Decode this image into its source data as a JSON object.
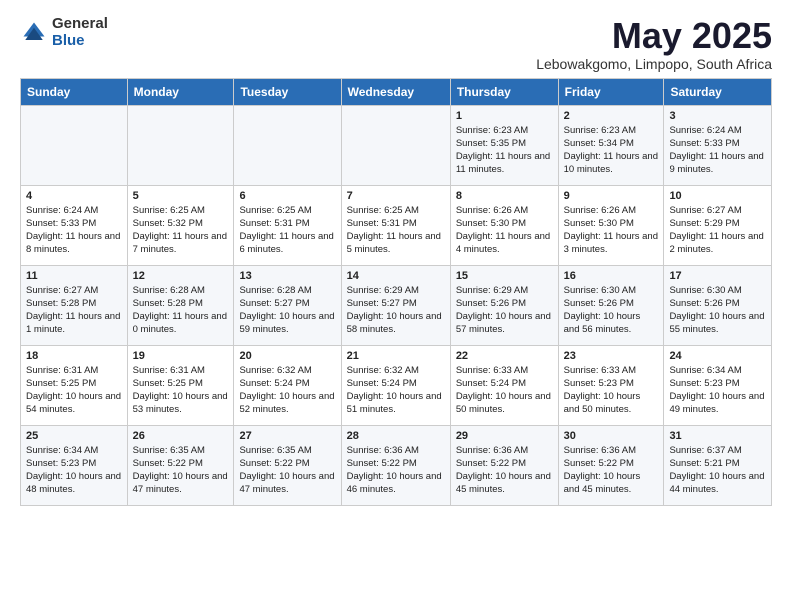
{
  "logo": {
    "general": "General",
    "blue": "Blue"
  },
  "header": {
    "month": "May 2025",
    "location": "Lebowakgomo, Limpopo, South Africa"
  },
  "days_of_week": [
    "Sunday",
    "Monday",
    "Tuesday",
    "Wednesday",
    "Thursday",
    "Friday",
    "Saturday"
  ],
  "weeks": [
    [
      {
        "day": "",
        "info": ""
      },
      {
        "day": "",
        "info": ""
      },
      {
        "day": "",
        "info": ""
      },
      {
        "day": "",
        "info": ""
      },
      {
        "day": "1",
        "info": "Sunrise: 6:23 AM\nSunset: 5:35 PM\nDaylight: 11 hours and 11 minutes."
      },
      {
        "day": "2",
        "info": "Sunrise: 6:23 AM\nSunset: 5:34 PM\nDaylight: 11 hours and 10 minutes."
      },
      {
        "day": "3",
        "info": "Sunrise: 6:24 AM\nSunset: 5:33 PM\nDaylight: 11 hours and 9 minutes."
      }
    ],
    [
      {
        "day": "4",
        "info": "Sunrise: 6:24 AM\nSunset: 5:33 PM\nDaylight: 11 hours and 8 minutes."
      },
      {
        "day": "5",
        "info": "Sunrise: 6:25 AM\nSunset: 5:32 PM\nDaylight: 11 hours and 7 minutes."
      },
      {
        "day": "6",
        "info": "Sunrise: 6:25 AM\nSunset: 5:31 PM\nDaylight: 11 hours and 6 minutes."
      },
      {
        "day": "7",
        "info": "Sunrise: 6:25 AM\nSunset: 5:31 PM\nDaylight: 11 hours and 5 minutes."
      },
      {
        "day": "8",
        "info": "Sunrise: 6:26 AM\nSunset: 5:30 PM\nDaylight: 11 hours and 4 minutes."
      },
      {
        "day": "9",
        "info": "Sunrise: 6:26 AM\nSunset: 5:30 PM\nDaylight: 11 hours and 3 minutes."
      },
      {
        "day": "10",
        "info": "Sunrise: 6:27 AM\nSunset: 5:29 PM\nDaylight: 11 hours and 2 minutes."
      }
    ],
    [
      {
        "day": "11",
        "info": "Sunrise: 6:27 AM\nSunset: 5:28 PM\nDaylight: 11 hours and 1 minute."
      },
      {
        "day": "12",
        "info": "Sunrise: 6:28 AM\nSunset: 5:28 PM\nDaylight: 11 hours and 0 minutes."
      },
      {
        "day": "13",
        "info": "Sunrise: 6:28 AM\nSunset: 5:27 PM\nDaylight: 10 hours and 59 minutes."
      },
      {
        "day": "14",
        "info": "Sunrise: 6:29 AM\nSunset: 5:27 PM\nDaylight: 10 hours and 58 minutes."
      },
      {
        "day": "15",
        "info": "Sunrise: 6:29 AM\nSunset: 5:26 PM\nDaylight: 10 hours and 57 minutes."
      },
      {
        "day": "16",
        "info": "Sunrise: 6:30 AM\nSunset: 5:26 PM\nDaylight: 10 hours and 56 minutes."
      },
      {
        "day": "17",
        "info": "Sunrise: 6:30 AM\nSunset: 5:26 PM\nDaylight: 10 hours and 55 minutes."
      }
    ],
    [
      {
        "day": "18",
        "info": "Sunrise: 6:31 AM\nSunset: 5:25 PM\nDaylight: 10 hours and 54 minutes."
      },
      {
        "day": "19",
        "info": "Sunrise: 6:31 AM\nSunset: 5:25 PM\nDaylight: 10 hours and 53 minutes."
      },
      {
        "day": "20",
        "info": "Sunrise: 6:32 AM\nSunset: 5:24 PM\nDaylight: 10 hours and 52 minutes."
      },
      {
        "day": "21",
        "info": "Sunrise: 6:32 AM\nSunset: 5:24 PM\nDaylight: 10 hours and 51 minutes."
      },
      {
        "day": "22",
        "info": "Sunrise: 6:33 AM\nSunset: 5:24 PM\nDaylight: 10 hours and 50 minutes."
      },
      {
        "day": "23",
        "info": "Sunrise: 6:33 AM\nSunset: 5:23 PM\nDaylight: 10 hours and 50 minutes."
      },
      {
        "day": "24",
        "info": "Sunrise: 6:34 AM\nSunset: 5:23 PM\nDaylight: 10 hours and 49 minutes."
      }
    ],
    [
      {
        "day": "25",
        "info": "Sunrise: 6:34 AM\nSunset: 5:23 PM\nDaylight: 10 hours and 48 minutes."
      },
      {
        "day": "26",
        "info": "Sunrise: 6:35 AM\nSunset: 5:22 PM\nDaylight: 10 hours and 47 minutes."
      },
      {
        "day": "27",
        "info": "Sunrise: 6:35 AM\nSunset: 5:22 PM\nDaylight: 10 hours and 47 minutes."
      },
      {
        "day": "28",
        "info": "Sunrise: 6:36 AM\nSunset: 5:22 PM\nDaylight: 10 hours and 46 minutes."
      },
      {
        "day": "29",
        "info": "Sunrise: 6:36 AM\nSunset: 5:22 PM\nDaylight: 10 hours and 45 minutes."
      },
      {
        "day": "30",
        "info": "Sunrise: 6:36 AM\nSunset: 5:22 PM\nDaylight: 10 hours and 45 minutes."
      },
      {
        "day": "31",
        "info": "Sunrise: 6:37 AM\nSunset: 5:21 PM\nDaylight: 10 hours and 44 minutes."
      }
    ]
  ]
}
